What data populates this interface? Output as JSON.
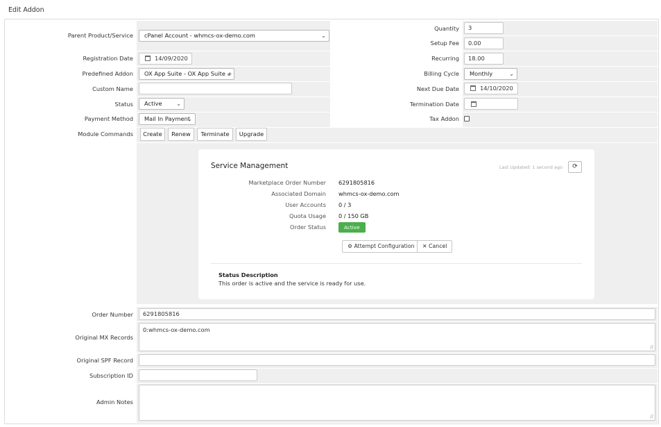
{
  "page_title": "Edit Addon",
  "form": {
    "parent_product_label": "Parent Product/Service",
    "parent_product_value": "cPanel Account - whmcs-ox-demo.com",
    "registration_date_label": "Registration Date",
    "registration_date_value": "14/09/2020",
    "predefined_addon_label": "Predefined Addon",
    "predefined_addon_value": "OX App Suite - OX App Suite + F",
    "custom_name_label": "Custom Name",
    "custom_name_value": "",
    "status_label": "Status",
    "status_value": "Active",
    "payment_method_label": "Payment Method",
    "payment_method_value": "Mail In Payment",
    "module_commands_label": "Module Commands",
    "module_buttons": [
      "Create",
      "Renew",
      "Terminate",
      "Upgrade"
    ],
    "quantity_label": "Quantity",
    "quantity_value": "3",
    "setup_fee_label": "Setup Fee",
    "setup_fee_value": "0.00",
    "recurring_label": "Recurring",
    "recurring_value": "18.00",
    "billing_cycle_label": "Billing Cycle",
    "billing_cycle_value": "Monthly",
    "next_due_date_label": "Next Due Date",
    "next_due_date_value": "14/10/2020",
    "termination_date_label": "Termination Date",
    "termination_date_value": "",
    "tax_addon_label": "Tax Addon",
    "tax_addon_checked": false,
    "order_number_label": "Order Number",
    "order_number_value": "6291805816",
    "original_mx_label": "Original MX Records",
    "original_mx_value": "0:whmcs-ox-demo.com",
    "original_spf_label": "Original SPF Record",
    "original_spf_value": "",
    "subscription_id_label": "Subscription ID",
    "subscription_id_value": "",
    "admin_notes_label": "Admin Notes",
    "admin_notes_value": ""
  },
  "service_management": {
    "title": "Service Management",
    "last_updated": "Last Updated: 1 second ago",
    "rows": [
      {
        "label": "Marketplace Order Number",
        "value": "6291805816"
      },
      {
        "label": "Associated Domain",
        "value": "whmcs-ox-demo.com"
      },
      {
        "label": "User Accounts",
        "value": "0 / 3"
      },
      {
        "label": "Quota Usage",
        "value": "0 / 150 GB"
      }
    ],
    "order_status_label": "Order Status",
    "order_status_value": "Active",
    "attempt_configuration_label": "Attempt Configuration",
    "cancel_label": "Cancel",
    "status_description_title": "Status Description",
    "status_description_text": "This order is active and the service is ready for use."
  },
  "colors": {
    "field_background": "#efefef",
    "badge_active": "#4cae4c",
    "border": "#dcdcdc"
  },
  "icons": [
    "calendar-icon",
    "refresh-icon",
    "gear-icon",
    "close-icon",
    "chevron-down-icon",
    "resize-grip-icon"
  ]
}
